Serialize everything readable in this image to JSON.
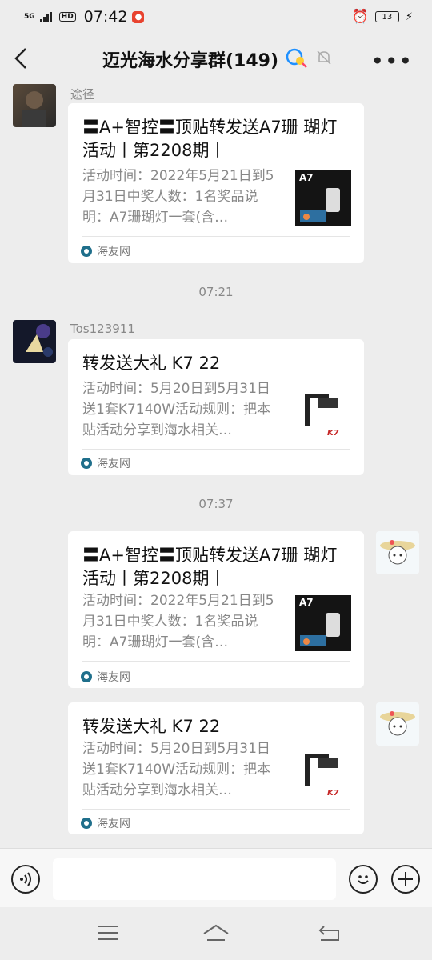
{
  "status_bar": {
    "network": "5G",
    "hd": "HD",
    "time": "07:42",
    "battery": "13"
  },
  "header": {
    "title": "迈光海水分享群(149)"
  },
  "messages": [
    {
      "sender": "途径",
      "card": {
        "title": "〓A+智控〓顶贴转发送A7珊 瑚灯活动丨第2208期丨",
        "description": "活动时间：2022年5月21日到5月31日中奖人数：1名奖品说明：A7珊瑚灯一套(含…",
        "thumb_label": "A7",
        "source": "海友网"
      }
    },
    {
      "sender": "Tos123911",
      "card": {
        "title": "转发送大礼 K7 22",
        "description": "活动时间：5月20日到5月31日送1套K7140W活动规则：把本贴活动分享到海水相关…",
        "thumb_label": "K7",
        "source": "海友网"
      }
    },
    {
      "sender": "",
      "card": {
        "title": "〓A+智控〓顶贴转发送A7珊 瑚灯活动丨第2208期丨",
        "description": "活动时间：2022年5月21日到5月31日中奖人数：1名奖品说明：A7珊瑚灯一套(含…",
        "thumb_label": "A7",
        "source": "海友网"
      }
    },
    {
      "sender": "",
      "card": {
        "title": "转发送大礼 K7 22",
        "description": "活动时间：5月20日到5月31日送1套K7140W活动规则：把本贴活动分享到海水相关…",
        "thumb_label": "K7",
        "source": "海友网"
      }
    }
  ],
  "timestamps": [
    "07:21",
    "07:37"
  ],
  "input": {
    "placeholder": ""
  },
  "colors": {
    "background": "#ededed",
    "card": "#ffffff",
    "muted_text": "#888888"
  }
}
